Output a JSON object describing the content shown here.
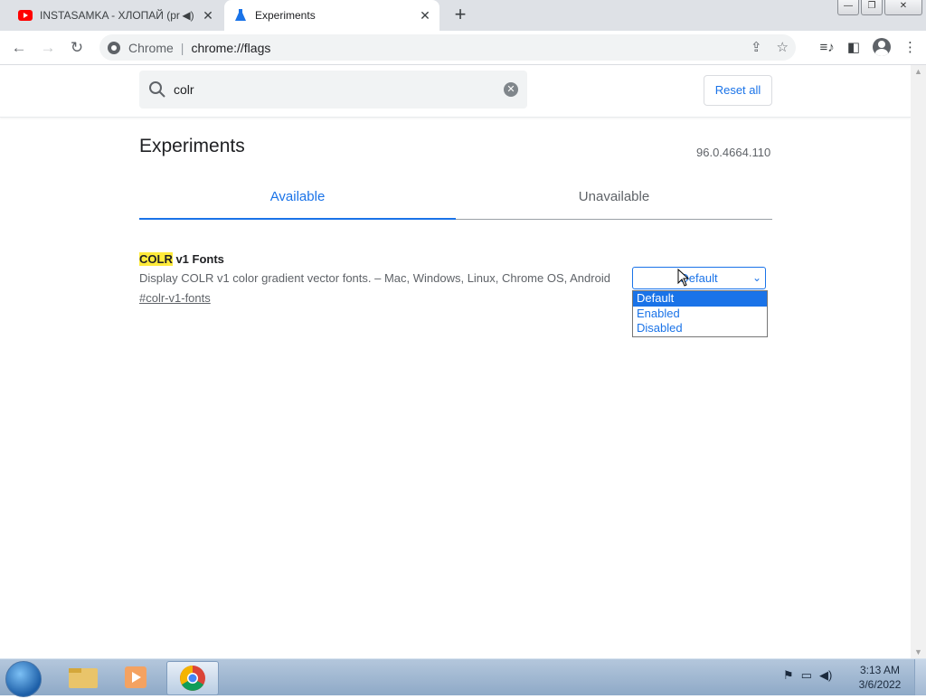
{
  "browser": {
    "tabs": [
      {
        "title": "INSTASAMKA - ХЛОПАЙ (pr",
        "active": false,
        "icon": "youtube-icon",
        "audio": true
      },
      {
        "title": "Experiments",
        "active": true,
        "icon": "flask-icon"
      }
    ],
    "omnibox": {
      "scheme_label": "Chrome",
      "url": "chrome://flags"
    }
  },
  "page": {
    "search_value": "colr",
    "reset_label": "Reset all",
    "title": "Experiments",
    "version": "96.0.4664.110",
    "tabs": {
      "available": "Available",
      "unavailable": "Unavailable"
    },
    "flag": {
      "name_highlight": "COLR",
      "name_rest": " v1 Fonts",
      "description": "Display COLR v1 color gradient vector fonts. – Mac, Windows, Linux, Chrome OS, Android",
      "link": "#colr-v1-fonts",
      "selected": "Default",
      "options": [
        "Default",
        "Enabled",
        "Disabled"
      ]
    }
  },
  "taskbar": {
    "time": "3:13 AM",
    "date": "3/6/2022"
  },
  "colors": {
    "accent": "#1a73e8",
    "highlight": "#ffeb3b"
  }
}
